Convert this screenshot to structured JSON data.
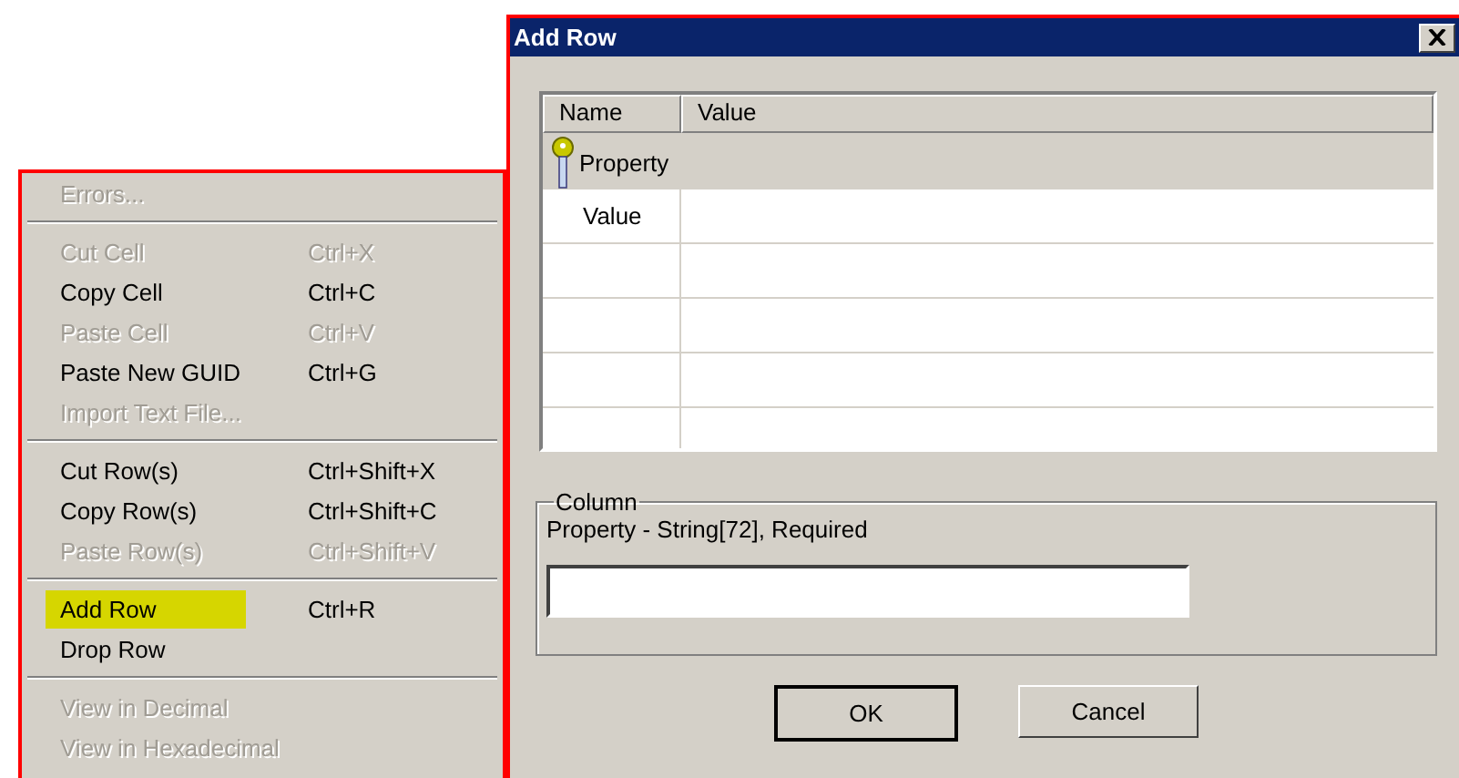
{
  "context_menu": {
    "groups": [
      {
        "items": [
          {
            "label": "Errors...",
            "disabled": true,
            "highlighted": false
          }
        ]
      },
      {
        "items": [
          {
            "label": "Cut Cell",
            "shortcut": "Ctrl+X",
            "disabled": true,
            "highlighted": false
          },
          {
            "label": "Copy Cell",
            "shortcut": "Ctrl+C",
            "disabled": false,
            "highlighted": false
          },
          {
            "label": "Paste Cell",
            "shortcut": "Ctrl+V",
            "disabled": true,
            "highlighted": false
          },
          {
            "label": "Paste New GUID",
            "shortcut": "Ctrl+G",
            "disabled": false,
            "highlighted": false
          },
          {
            "label": "Import Text File...",
            "disabled": true,
            "highlighted": false
          }
        ]
      },
      {
        "items": [
          {
            "label": "Cut Row(s)",
            "shortcut": "Ctrl+Shift+X",
            "disabled": false,
            "highlighted": false
          },
          {
            "label": "Copy Row(s)",
            "shortcut": "Ctrl+Shift+C",
            "disabled": false,
            "highlighted": false
          },
          {
            "label": "Paste Row(s)",
            "shortcut": "Ctrl+Shift+V",
            "disabled": true,
            "highlighted": false
          }
        ]
      },
      {
        "items": [
          {
            "label": "Add Row",
            "shortcut": "Ctrl+R",
            "disabled": false,
            "highlighted": true
          },
          {
            "label": "Drop Row",
            "disabled": false,
            "highlighted": false
          }
        ]
      },
      {
        "items": [
          {
            "label": "View in Decimal",
            "disabled": true,
            "highlighted": false
          },
          {
            "label": "View in Hexadecimal",
            "disabled": true,
            "highlighted": false
          }
        ]
      }
    ]
  },
  "dialog": {
    "title": "Add Row",
    "table": {
      "columns": [
        "Name",
        "Value"
      ],
      "group_row": {
        "label": "Property"
      },
      "rows": [
        {
          "name": "Value"
        }
      ]
    },
    "column_group": {
      "title": "Column",
      "description": "Property - String[72], Required"
    },
    "buttons": [
      {
        "label": "OK",
        "default": true
      },
      {
        "label": "Cancel",
        "default": false
      }
    ]
  }
}
